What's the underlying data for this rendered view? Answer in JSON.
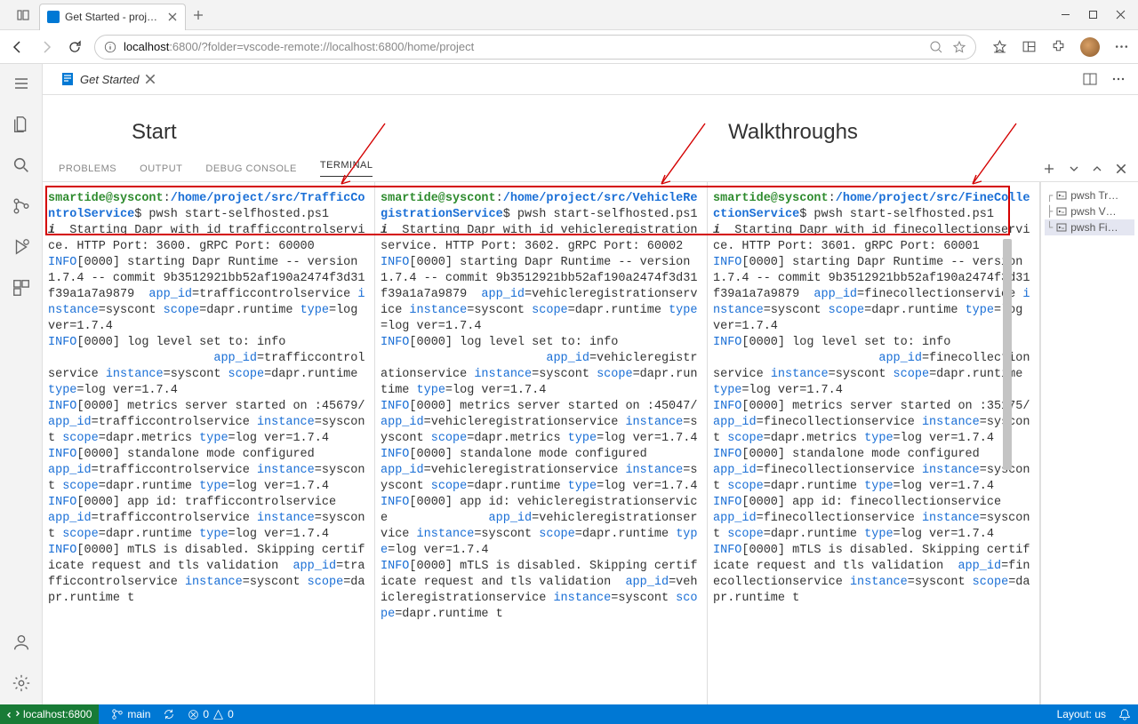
{
  "browser": {
    "tab_title": "Get Started - project - Ope",
    "url_host": "localhost",
    "url_port": ":6800",
    "url_path": "/?folder=vscode-remote://localhost:6800/home/project"
  },
  "editor": {
    "tab_label": "Get Started",
    "welcome_start": "Start",
    "welcome_walkthroughs": "Walkthroughs"
  },
  "panel_tabs": {
    "problems": "PROBLEMS",
    "output": "OUTPUT",
    "debug_console": "DEBUG CONSOLE",
    "terminal": "TERMINAL"
  },
  "terminal_sidebar": [
    {
      "tree": "┌",
      "name": "pwsh Tr…"
    },
    {
      "tree": "├",
      "name": "pwsh V…"
    },
    {
      "tree": "└",
      "name": "pwsh Fi…"
    }
  ],
  "terminals": [
    {
      "user": "smartide@syscont",
      "path": "/home/project/src/TrafficControlService",
      "cmd": "pwsh start-selfhosted.ps1",
      "starting": "Starting Dapr with id trafficcontrolservice. HTTP Port: 3600. gRPC Port: 60000",
      "runtime": "starting Dapr Runtime -- version 1.7.4 -- commit 9b3512921bb52af190a2474f3d31f39a1a7a9879",
      "app_id": "trafficcontrolservice",
      "instance": "syscont",
      "loglevel": "log level set to: info",
      "app_short": "trafficcontrolservice",
      "metrics_port": "45679",
      "app_id_line": "app id: trafficcontrolservice"
    },
    {
      "user": "smartide@syscont",
      "path": "/home/project/src/VehicleRegistrationService",
      "cmd": "pwsh start-selfhosted.ps1",
      "starting": "Starting Dapr with id vehicleregistrationservice. HTTP Port: 3602. gRPC Port: 60002",
      "runtime": "starting Dapr Runtime -- version 1.7.4 -- commit 9b3512921bb52af190a2474f3d31f39a1a7a9879",
      "app_id": "vehicleregistrationservice",
      "instance": "syscont",
      "loglevel": "log level set to: info",
      "app_short": "vehicleregistrationservice",
      "metrics_port": "45047",
      "app_id_line": "app id: vehicleregistrationservice"
    },
    {
      "user": "smartide@syscont",
      "path": "/home/project/src/FineCollectionService",
      "cmd": "pwsh start-selfhosted.ps1",
      "starting": "Starting Dapr with id finecollectionservice. HTTP Port: 3601. gRPC Port: 60001",
      "runtime": "starting Dapr Runtime -- version 1.7.4 -- commit 9b3512921bb52af190a2474f3d31f39a1a7a9879",
      "app_id": "finecollectionservice",
      "instance": "syscont",
      "loglevel": "log level set to: info",
      "app_short": "finecollectionservice",
      "metrics_port": "35175",
      "app_id_line": "app id: finecollectionservice"
    }
  ],
  "status_bar": {
    "remote": "localhost:6800",
    "branch": "main",
    "errors": "0",
    "warnings": "0",
    "layout": "Layout: us"
  }
}
